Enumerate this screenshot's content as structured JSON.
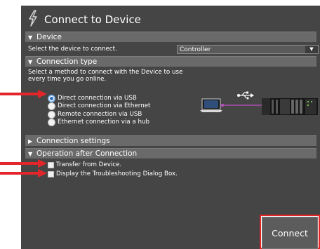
{
  "dialog": {
    "title": "Connect to Device",
    "device": {
      "header": "Device",
      "prompt": "Select the device to connect.",
      "selected": "Controller"
    },
    "connection_type": {
      "header": "Connection type",
      "description_line1": "Select a method to connect with the Device to use",
      "description_line2": "every time you go online.",
      "options": [
        {
          "label": "Direct connection via USB",
          "selected": true
        },
        {
          "label": "Direct connection via Ethernet",
          "selected": false
        },
        {
          "label": "Remote connection via USB",
          "selected": false
        },
        {
          "label": "Ethernet connection via a hub",
          "selected": false
        }
      ]
    },
    "connection_settings": {
      "header": "Connection settings"
    },
    "operation_after_connection": {
      "header": "Operation after Connection",
      "options": [
        {
          "label": "Transfer from Device.",
          "checked": false
        },
        {
          "label": "Display the Troubleshooting Dialog Box.",
          "checked": false
        }
      ]
    },
    "connect_label": "Connect"
  },
  "icons": {
    "title": "lightning-icon",
    "expanded": "triangle-down-icon",
    "collapsed": "triangle-right-icon",
    "usb": "usb-icon",
    "laptop": "laptop-icon",
    "controller": "plc-controller-icon",
    "annotation": "red-arrow-icon"
  },
  "colors": {
    "panel": "#454545",
    "section_header": "#6a6a6a",
    "annotation": "#e3262a",
    "cable": "#c24fc4"
  }
}
